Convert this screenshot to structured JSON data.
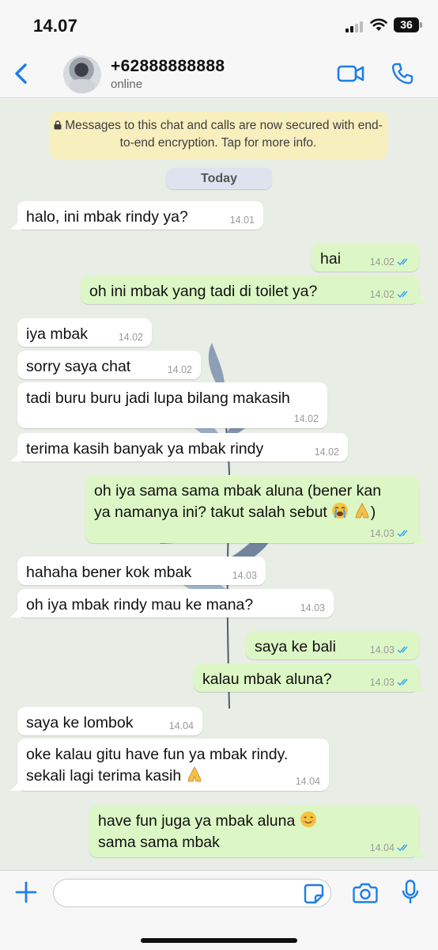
{
  "status": {
    "time": "14.07",
    "battery": "36"
  },
  "header": {
    "contact": "+62888888888",
    "status": "online"
  },
  "encryption_notice": "Messages to this chat and calls are now secured with end-to-end encryption. Tap for more info.",
  "day_label": "Today",
  "messages": [
    {
      "dir": "in",
      "text": "halo, ini mbak rindy ya?",
      "time": "14.01"
    },
    {
      "dir": "out",
      "text": "hai",
      "time": "14.02"
    },
    {
      "dir": "out",
      "text": "oh ini mbak yang tadi di toilet ya?",
      "time": "14.02"
    },
    {
      "dir": "in",
      "text": "iya mbak",
      "time": "14.02"
    },
    {
      "dir": "in",
      "text": "sorry saya chat",
      "time": "14.02"
    },
    {
      "dir": "in",
      "text": "tadi buru buru jadi lupa bilang makasih",
      "time": "14.02"
    },
    {
      "dir": "in",
      "text": "terima kasih banyak ya mbak rindy",
      "time": "14.02"
    },
    {
      "dir": "out",
      "text_line1": "oh iya sama sama mbak aluna (bener kan",
      "text_line2": "ya namanya ini? takut salah sebut",
      "text_end": ")",
      "time": "14.03"
    },
    {
      "dir": "in",
      "text": "hahaha bener kok mbak",
      "time": "14.03"
    },
    {
      "dir": "in",
      "text": "oh iya mbak rindy mau ke mana?",
      "time": "14.03"
    },
    {
      "dir": "out",
      "text": "saya ke bali",
      "time": "14.03"
    },
    {
      "dir": "out",
      "text": "kalau mbak aluna?",
      "time": "14.03"
    },
    {
      "dir": "in",
      "text": "saya ke lombok",
      "time": "14.04"
    },
    {
      "dir": "in",
      "text_line1": "oke kalau gitu have fun ya mbak rindy.",
      "text_line2": "sekali lagi terima kasih",
      "time": "14.04"
    },
    {
      "dir": "out",
      "text_line1": "have fun juga ya mbak aluna",
      "text_line2": "sama sama mbak",
      "time": "14.04"
    }
  ],
  "composer": {
    "placeholder": ""
  },
  "icons": {
    "back": "chevron-left-icon",
    "video": "video-call-icon",
    "call": "phone-icon",
    "plus": "plus-icon",
    "sticker": "sticker-icon",
    "camera": "camera-icon",
    "mic": "microphone-icon",
    "read_receipt": "double-check-icon"
  },
  "colors": {
    "accent": "#1f7fe6",
    "incoming": "#ffffff",
    "outgoing": "#dcf7c5",
    "chat_bg": "#e8ede6",
    "ticks": "#3ba6f5"
  }
}
